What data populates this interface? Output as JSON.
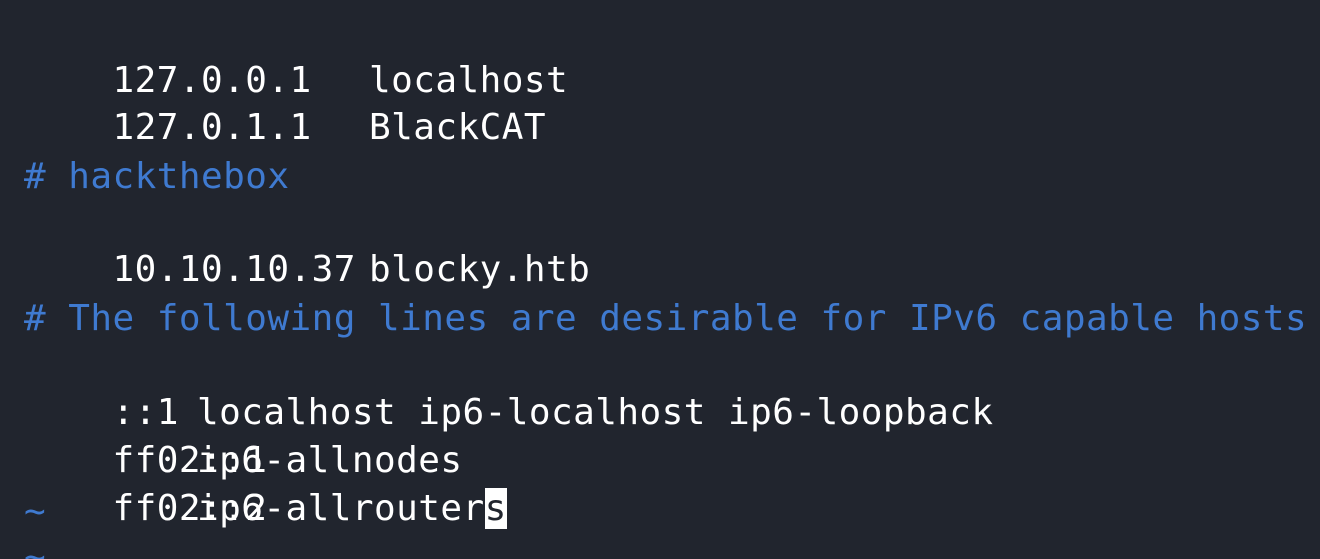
{
  "hosts_file": {
    "line1": {
      "ip": "127.0.0.1",
      "host": "localhost"
    },
    "line2": {
      "ip": "127.0.1.1",
      "host": "BlackCAT"
    },
    "comment1": "# hackthebox",
    "line3": {
      "ip": "10.10.10.37",
      "host": "blocky.htb"
    },
    "comment2": "# The following lines are desirable for IPv6 capable hosts",
    "line4": {
      "ip": "::1",
      "host": "localhost ip6-localhost ip6-loopback"
    },
    "line5": {
      "ip": "ff02::1",
      "host": "ip6-allnodes"
    },
    "line6": {
      "ip": "ff02::2",
      "host_prefix": "ip6-allrouter",
      "cursor_char": "s"
    },
    "tilde": "~"
  },
  "colors": {
    "background": "#21252e",
    "text": "#ffffff",
    "comment": "#3f7ad0",
    "cursor": "#ffffff"
  }
}
